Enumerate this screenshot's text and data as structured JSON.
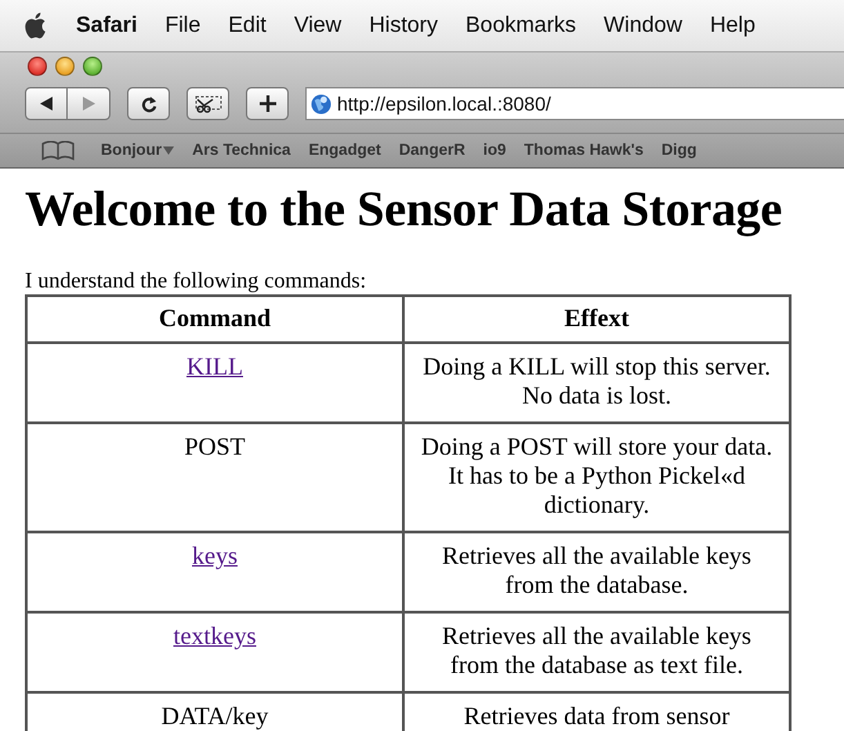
{
  "menu_bar": {
    "app": "Safari",
    "items": [
      "File",
      "Edit",
      "View",
      "History",
      "Bookmarks",
      "Window",
      "Help"
    ]
  },
  "toolbar": {
    "address": "http://epsilon.local.:8080/"
  },
  "bookmarks_bar": [
    {
      "label": "Bonjour",
      "menu": true
    },
    {
      "label": "Ars Technica",
      "menu": false
    },
    {
      "label": "Engadget",
      "menu": false
    },
    {
      "label": "DangerR",
      "menu": false
    },
    {
      "label": "io9",
      "menu": false
    },
    {
      "label": "Thomas Hawk's",
      "menu": false
    },
    {
      "label": "Digg",
      "menu": false
    }
  ],
  "page": {
    "heading": "Welcome to the Sensor Data Storage",
    "intro": "I understand the following commands:",
    "table": {
      "columns": [
        "Command",
        "Effext"
      ],
      "rows": [
        {
          "command": "KILL",
          "kind": "link",
          "effect": "Doing a KILL will stop this server. No data is lost."
        },
        {
          "command": "POST",
          "kind": "plain",
          "effect": "Doing a POST will store your data. It has to be a Python Pickel«d dictionary."
        },
        {
          "command": "keys",
          "kind": "link",
          "effect": "Retrieves all the available keys from the database."
        },
        {
          "command": "textkeys",
          "kind": "link",
          "effect": "Retrieves all the available keys from the database as text file."
        },
        {
          "command": "DATA/key",
          "kind": "plain",
          "effect": "Retrieves data from sensor"
        }
      ]
    }
  }
}
